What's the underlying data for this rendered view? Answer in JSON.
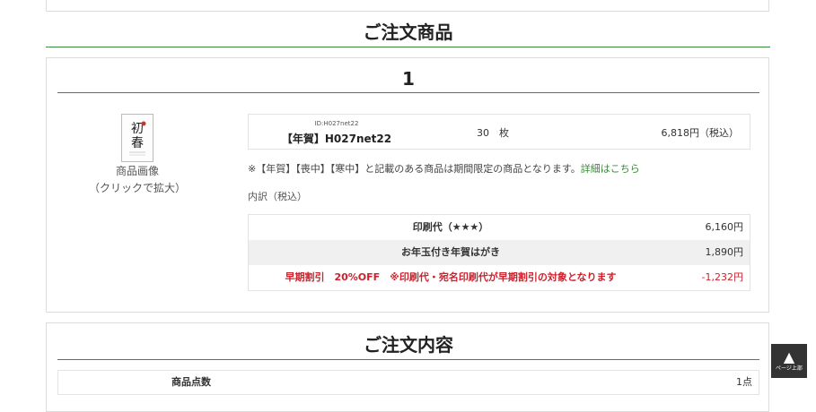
{
  "section_title": "ご注文商品",
  "item": {
    "number": "1",
    "thumb_caption_1": "商品画像",
    "thumb_caption_2": "（クリックで拡大）",
    "product_id": "ID:H027net22",
    "product_name": "【年賀】H027net22",
    "quantity": "30　枚",
    "price": "6,818円（税込）",
    "notice_text": "※【年賀】【喪中】【寒中】と記載のある商品は期間限定の商品となります。",
    "notice_link": "詳細はこちら",
    "breakdown_label": "内訳（税込）",
    "breakdown": [
      {
        "label": "印刷代（★★★）",
        "value": "6,160円"
      },
      {
        "label": "お年玉付き年賀はがき",
        "value": "1,890円"
      },
      {
        "label": "早期割引　20%OFF　※印刷代・宛名印刷代が早期割引の対象となります",
        "value": "-1,232円"
      }
    ]
  },
  "order_summary": {
    "title": "ご注文内容",
    "rows": [
      {
        "label": "商品点数",
        "value": "1点"
      }
    ]
  },
  "to_top": {
    "arrow": "▲",
    "label": "ページ上部"
  },
  "colors": {
    "accent_green": "#3b8a3b",
    "discount_red": "#d0202b",
    "link_green": "#3a8a3a"
  }
}
